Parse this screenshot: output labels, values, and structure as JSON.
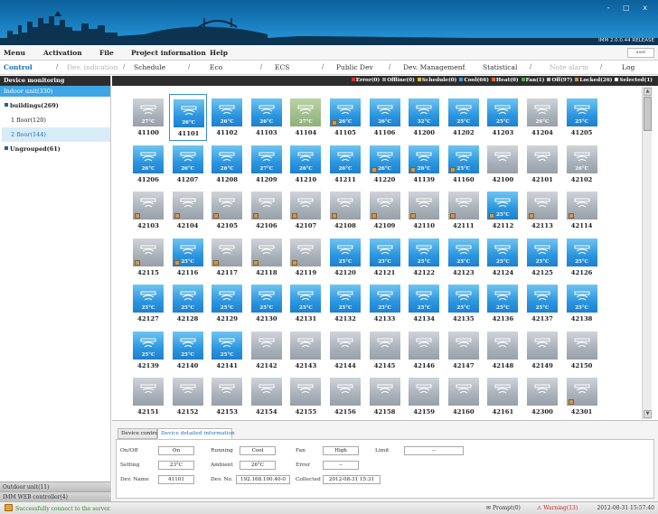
{
  "window": {
    "version": "IMM 2.0.0.44 RELEASE",
    "controls": "- □ x"
  },
  "menu": {
    "items": [
      "Menu",
      "Activation",
      "File",
      "Project information",
      "Help"
    ],
    "user": "user"
  },
  "tabs": [
    {
      "label": "Control",
      "state": "active"
    },
    {
      "label": "Dev. indication",
      "state": "dim"
    },
    {
      "label": "Schedule",
      "state": "normal"
    },
    {
      "label": "Eco",
      "state": "normal"
    },
    {
      "label": "ECS",
      "state": "normal"
    },
    {
      "label": "Public Dev",
      "state": "normal"
    },
    {
      "label": "Dev. Management",
      "state": "normal"
    },
    {
      "label": "Statistical",
      "state": "normal"
    },
    {
      "label": "Note alarm",
      "state": "dim"
    },
    {
      "label": "Log",
      "state": "normal"
    }
  ],
  "left": {
    "title": "Device monitoring",
    "indoor": "Indoor unit(330)",
    "tree": [
      {
        "label": "buildings(269)",
        "bold": true,
        "icon": "square-icon",
        "level": 1
      },
      {
        "label": "1 floor(120)",
        "bold": false,
        "level": 2
      },
      {
        "label": "2 floor(144)",
        "bold": false,
        "level": 2,
        "selected": true
      },
      {
        "label": "Ungrouped(61)",
        "bold": true,
        "icon": "square-icon",
        "level": 1
      }
    ],
    "bottom": [
      "Outdoor unit(11)",
      "IMM WEB controller(4)"
    ]
  },
  "statusbar": {
    "items": [
      {
        "label": "Error(0)",
        "color": "#e03030"
      },
      {
        "label": "Offline(0)",
        "color": "#9a9a9a"
      },
      {
        "label": "Schedule(0)",
        "color": "#e0c020"
      },
      {
        "label": "Cool(66)",
        "color": "#3aa0e8"
      },
      {
        "label": "Heat(0)",
        "color": "#e07020"
      },
      {
        "label": "Fan(1)",
        "color": "#40b040"
      },
      {
        "label": "Off(97)",
        "color": "#c8c8c8"
      },
      {
        "label": "Locked(26)",
        "color": "#c89a5a"
      },
      {
        "label": "Selected(1)",
        "color": "#ffffff"
      }
    ]
  },
  "devices": [
    [
      "41100",
      "off",
      "27°C",
      false
    ],
    [
      "41101",
      "on",
      "26°C",
      false
    ],
    [
      "41102",
      "on",
      "26°C",
      false
    ],
    [
      "41103",
      "on",
      "26°C",
      false
    ],
    [
      "41104",
      "green",
      "27°C",
      false
    ],
    [
      "41105",
      "on",
      "26°C",
      true
    ],
    [
      "41106",
      "on",
      "26°C",
      false
    ],
    [
      "41200",
      "on",
      "32°C",
      false
    ],
    [
      "41202",
      "on",
      "25°C",
      false
    ],
    [
      "41203",
      "on",
      "25°C",
      false
    ],
    [
      "41204",
      "off",
      "26°C",
      false
    ],
    [
      "41205",
      "on",
      "25°C",
      false
    ],
    [
      "41206",
      "on",
      "26°C",
      false
    ],
    [
      "41207",
      "on",
      "26°C",
      false
    ],
    [
      "41208",
      "on",
      "26°C",
      false
    ],
    [
      "41209",
      "on",
      "27°C",
      false
    ],
    [
      "41210",
      "on",
      "26°C",
      false
    ],
    [
      "41211",
      "on",
      "26°C",
      false
    ],
    [
      "41220",
      "on",
      "26°C",
      true
    ],
    [
      "41139",
      "on",
      "26°C",
      true
    ],
    [
      "41160",
      "on",
      "25°C",
      true
    ],
    [
      "42100",
      "off",
      "",
      false
    ],
    [
      "42101",
      "off",
      "",
      false
    ],
    [
      "42102",
      "off",
      "26°C",
      false
    ],
    [
      "42103",
      "off",
      "",
      true
    ],
    [
      "42104",
      "off",
      "",
      true
    ],
    [
      "42105",
      "off",
      "",
      true
    ],
    [
      "42106",
      "off",
      "",
      true
    ],
    [
      "42107",
      "off",
      "",
      true
    ],
    [
      "42108",
      "off",
      "",
      true
    ],
    [
      "42109",
      "off",
      "",
      true
    ],
    [
      "42110",
      "off",
      "",
      true
    ],
    [
      "42111",
      "off",
      "",
      true
    ],
    [
      "42112",
      "on",
      "25°C",
      true
    ],
    [
      "42113",
      "off",
      "",
      true
    ],
    [
      "42114",
      "off",
      "",
      true
    ],
    [
      "42115",
      "off",
      "",
      true
    ],
    [
      "42116",
      "on",
      "25°C",
      true
    ],
    [
      "42117",
      "off",
      "",
      true
    ],
    [
      "42118",
      "off",
      "",
      true
    ],
    [
      "42119",
      "off",
      "",
      true
    ],
    [
      "42120",
      "on",
      "25°C",
      false
    ],
    [
      "42121",
      "on",
      "25°C",
      false
    ],
    [
      "42122",
      "on",
      "25°C",
      false
    ],
    [
      "42123",
      "on",
      "25°C",
      false
    ],
    [
      "42124",
      "on",
      "25°C",
      false
    ],
    [
      "42125",
      "on",
      "25°C",
      false
    ],
    [
      "42126",
      "on",
      "25°C",
      false
    ],
    [
      "42127",
      "on",
      "25°C",
      false
    ],
    [
      "42128",
      "on",
      "25°C",
      false
    ],
    [
      "42129",
      "on",
      "25°C",
      false
    ],
    [
      "42130",
      "on",
      "25°C",
      false
    ],
    [
      "42131",
      "on",
      "25°C",
      false
    ],
    [
      "42132",
      "on",
      "25°C",
      false
    ],
    [
      "42133",
      "on",
      "25°C",
      false
    ],
    [
      "42134",
      "on",
      "25°C",
      false
    ],
    [
      "42135",
      "on",
      "25°C",
      false
    ],
    [
      "42136",
      "on",
      "25°C",
      false
    ],
    [
      "42137",
      "on",
      "25°C",
      false
    ],
    [
      "42138",
      "on",
      "25°C",
      false
    ],
    [
      "42139",
      "on",
      "25°C",
      false
    ],
    [
      "42140",
      "on",
      "25°C",
      false
    ],
    [
      "42141",
      "on",
      "25°C",
      false
    ],
    [
      "42142",
      "off",
      "",
      false
    ],
    [
      "42143",
      "off",
      "",
      false
    ],
    [
      "42144",
      "off",
      "",
      false
    ],
    [
      "42145",
      "off",
      "",
      false
    ],
    [
      "42146",
      "off",
      "",
      false
    ],
    [
      "42147",
      "off",
      "",
      false
    ],
    [
      "42148",
      "off",
      "",
      false
    ],
    [
      "42149",
      "off",
      "",
      false
    ],
    [
      "42150",
      "off",
      "",
      false
    ],
    [
      "42151",
      "off",
      "",
      false
    ],
    [
      "42152",
      "off",
      "",
      false
    ],
    [
      "42153",
      "off",
      "",
      false
    ],
    [
      "42154",
      "off",
      "",
      false
    ],
    [
      "42155",
      "off",
      "",
      false
    ],
    [
      "42156",
      "off",
      "",
      false
    ],
    [
      "42158",
      "off",
      "",
      false
    ],
    [
      "42159",
      "off",
      "",
      false
    ],
    [
      "42160",
      "off",
      "",
      false
    ],
    [
      "42161",
      "off",
      "",
      false
    ],
    [
      "42300",
      "off",
      "",
      false
    ],
    [
      "42301",
      "off",
      "",
      true
    ]
  ],
  "detail": {
    "tabs": [
      "Device control",
      "Device detailed information"
    ],
    "fields": {
      "onoff_label": "On/Off",
      "onoff": "On",
      "running_label": "Running",
      "running": "Cool",
      "fan_label": "Fan",
      "fan": "High",
      "limit_label": "Limit",
      "limit": "--",
      "setting_label": "Setting",
      "setting": "23°C",
      "ambient_label": "Ambient",
      "ambient": "26°C",
      "error_label": "Error",
      "error": "--",
      "devname_label": "Dev. Name",
      "devname": "41101",
      "devno_label": "Dev. No.",
      "devno": "192.168.100.40-0",
      "collected_label": "Collected",
      "collected": "2012-08-31 15:31"
    }
  },
  "bottom": {
    "message": "Successfully connect to the server.",
    "prompt": "Prompt(0)",
    "warning": "Warning(13)",
    "clock": "2012-08-31 15:57:40"
  }
}
